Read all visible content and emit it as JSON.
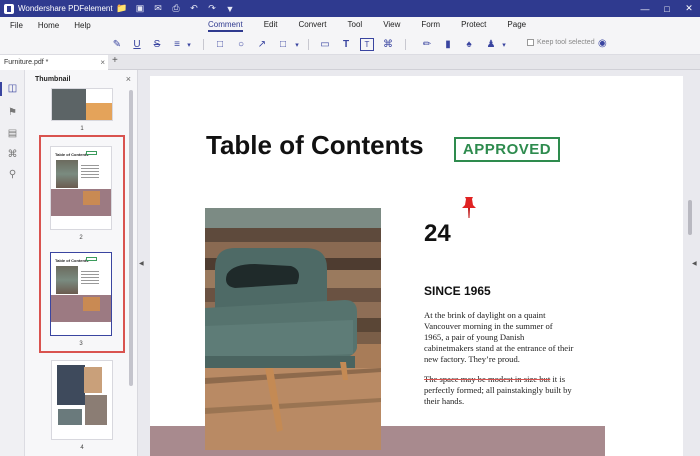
{
  "app": {
    "title": "Wondershare PDFelement"
  },
  "quick_access": [
    "folder-icon",
    "save-icon",
    "mail-icon",
    "print-icon",
    "undo-icon",
    "redo-icon",
    "pin-menu-icon"
  ],
  "window_controls": {
    "minimize": "—",
    "maximize": "□",
    "close": "✕"
  },
  "menu": {
    "left": [
      "File",
      "Home",
      "Help"
    ],
    "main": [
      "Comment",
      "Edit",
      "Convert",
      "Tool",
      "View",
      "Form",
      "Protect",
      "Page"
    ],
    "active": "Comment"
  },
  "toolbar": {
    "keep_tool_label": "Keep tool selected"
  },
  "tab": {
    "filename": "Furniture.pdf *",
    "close": "×",
    "add": "+"
  },
  "thumbnail_panel": {
    "title": "Thumbnail",
    "close": "×",
    "pages": [
      "1",
      "2",
      "3",
      "4"
    ]
  },
  "document": {
    "title": "Table of Contents",
    "stamp": "APPROVED",
    "page_number": "24",
    "heading": "SINCE 1965",
    "paragraph1": "At the brink of daylight on a quaint Vancouver morning in the summer of 1965, a pair of young Danish cabinetmakers stand at the entrance of their new factory. They’re proud.",
    "paragraph2_struck": "The space may be modest in size but",
    "paragraph2_rest": " it is perfectly formed; all painstakingly built by their hands."
  },
  "thumbnail_mini": {
    "title": "Table of Contents"
  },
  "colors": {
    "brand": "#2f3a8f",
    "stamp_green": "#2e8b4e",
    "selection_red": "#d9534f",
    "band_mauve": "#a88a8e"
  }
}
